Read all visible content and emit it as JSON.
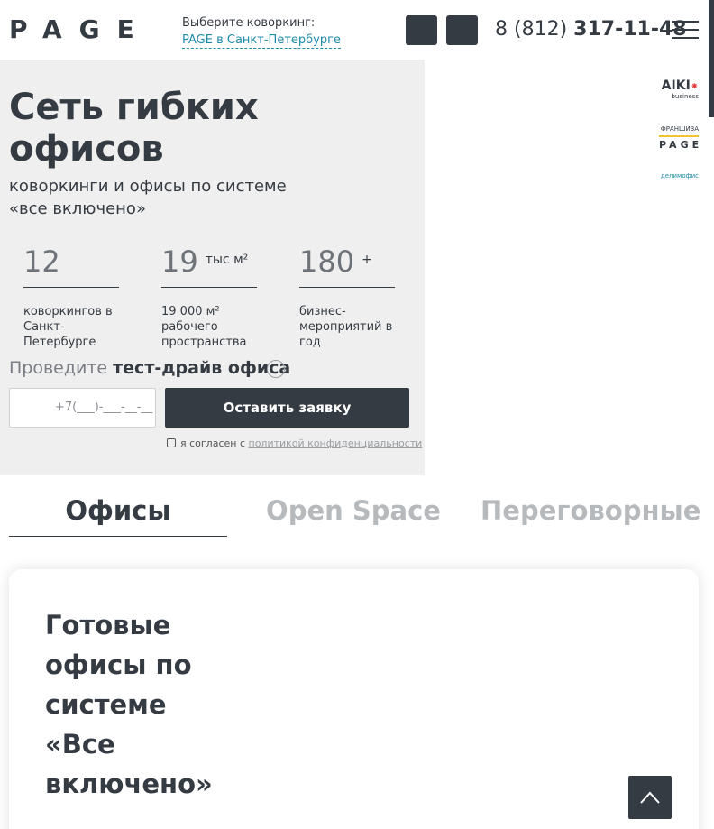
{
  "header": {
    "logo": "PAGE",
    "city_label": "Выберите коворкинг:",
    "city_value": "PAGE в Санкт-Петербурге",
    "phone_prefix": "8 (812)",
    "phone_number": "317-11-48"
  },
  "hero": {
    "title": "Сеть гибких офисов",
    "subtitle": "коворкинги и офисы по системе «все включено»",
    "stats": [
      {
        "value": "12",
        "unit": "",
        "description": "коворкингов в Санкт-Петербурге"
      },
      {
        "value": "19",
        "unit": "тыс м²",
        "description": "19 000 м² рабочего пространства"
      },
      {
        "value": "180",
        "unit": "+",
        "description": "бизнес-мероприятий в год"
      }
    ],
    "test_drive_prefix": "Проведите",
    "test_drive_bold": "тест-драйв офиса",
    "phone_placeholder": "+7(___)-___-__-__",
    "submit_label": "Оставить заявку",
    "agree_text": "я согласен с",
    "agree_link": "политикой конфиденциальности"
  },
  "partners": {
    "aiki": "AIKI",
    "aiki_sub": "business",
    "franchise_label": "ФРАНШИЗА",
    "franchise_logo": "PAGE",
    "delimofis": "делимофис"
  },
  "tabs": [
    {
      "label": "Офисы",
      "active": true
    },
    {
      "label": "Open Space",
      "active": false
    },
    {
      "label": "Переговорные",
      "active": false
    }
  ],
  "card": {
    "title": "Готовые офисы по системе «Все включено»"
  },
  "icons": {
    "social_1": "social-icon",
    "social_2": "social-icon",
    "menu": "burger-menu-icon",
    "scroll_top": "arrow-up-icon"
  },
  "colors": {
    "primary": "#353b42",
    "link": "#1e8ba8",
    "hero_bg": "#efefef"
  }
}
